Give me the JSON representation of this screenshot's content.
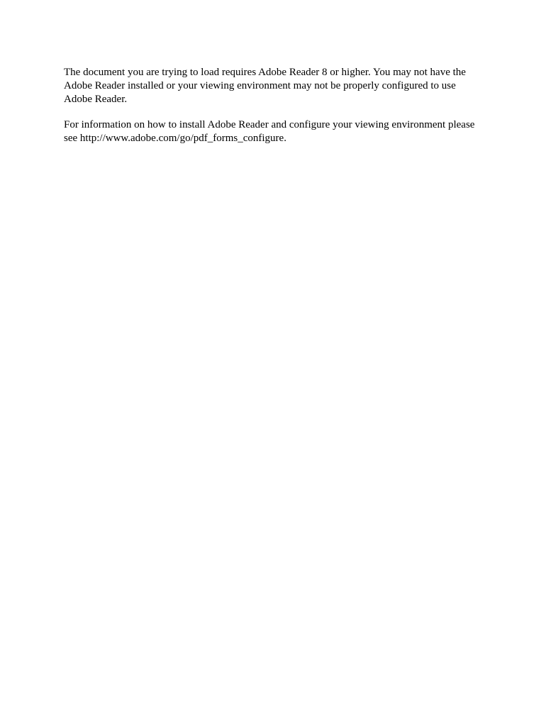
{
  "paragraphs": {
    "p1": "The document you are trying to load requires Adobe Reader 8 or higher. You may not have the Adobe Reader installed or your viewing environment may not be properly configured to use Adobe Reader.",
    "p2_prefix": "For information on how to install Adobe Reader and configure your viewing environment please see  ",
    "p2_link": "http://www.adobe.com/go/pdf_forms_configure",
    "p2_suffix": "."
  }
}
